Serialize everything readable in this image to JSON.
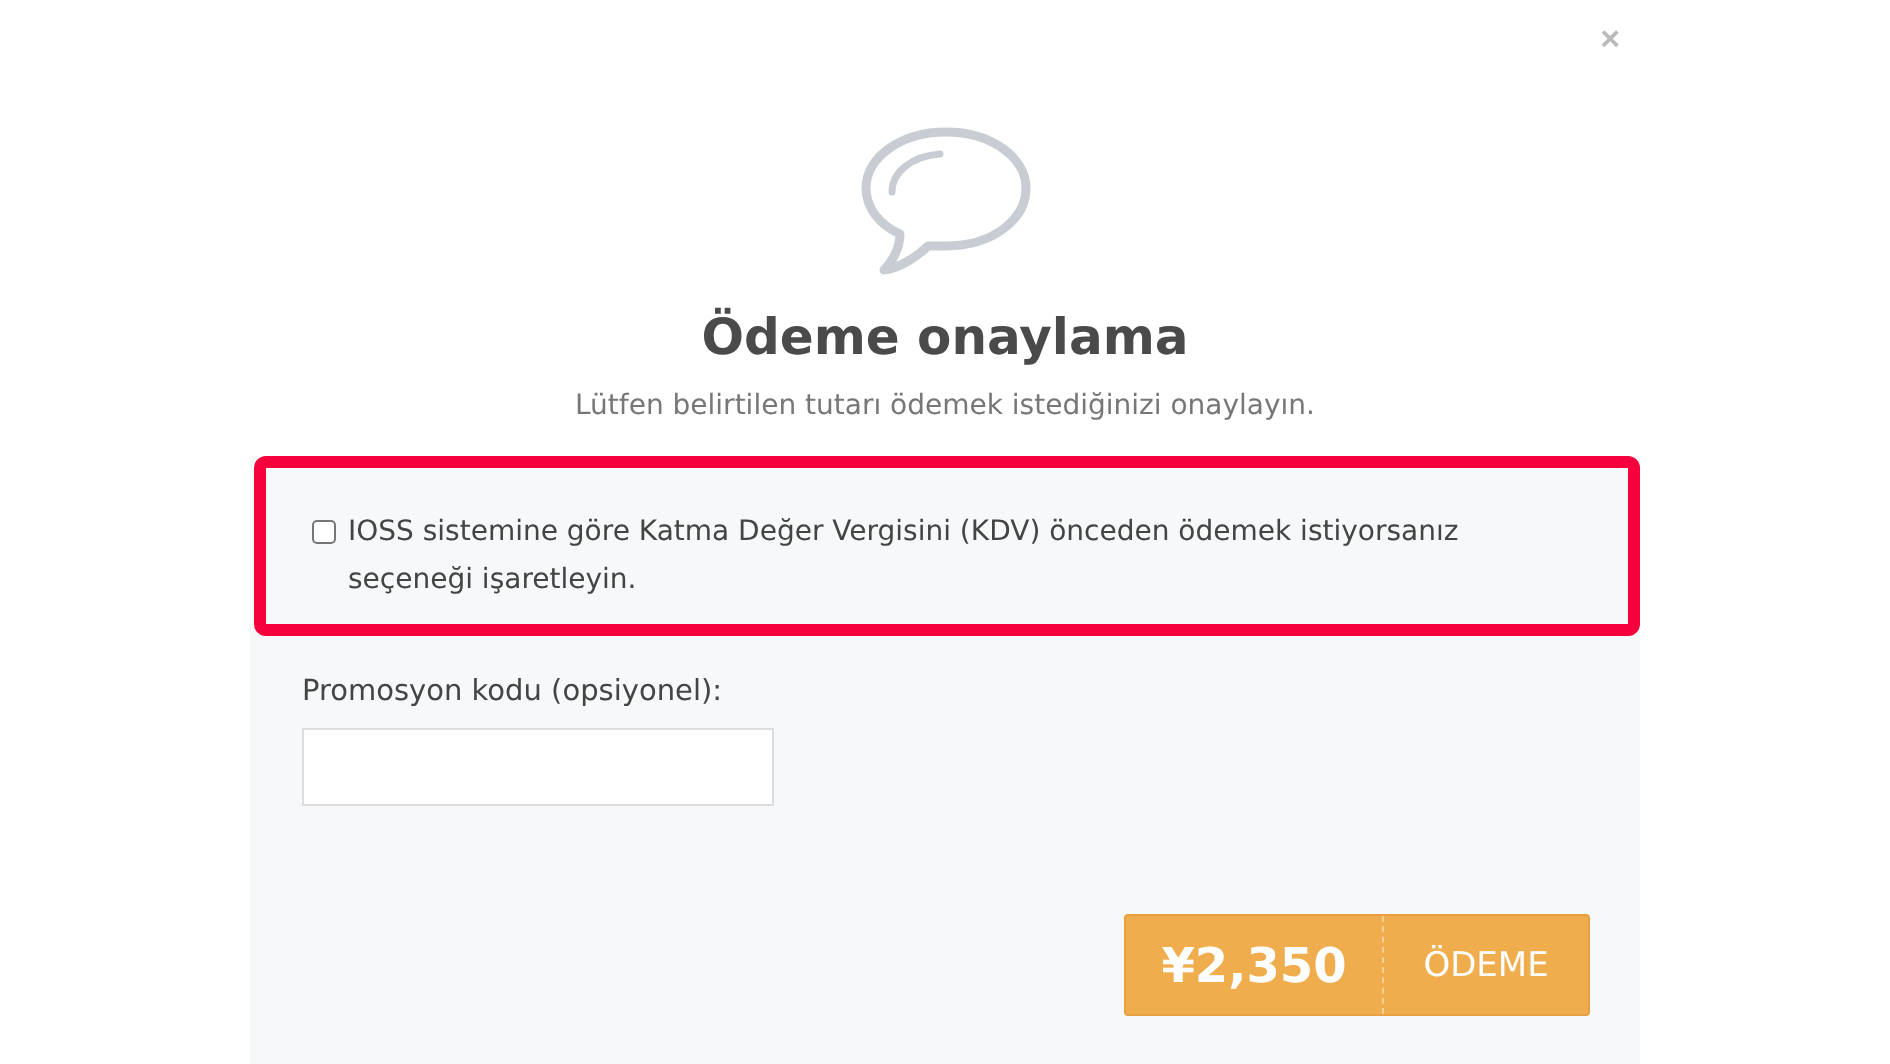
{
  "dialog": {
    "close": "×",
    "title": "Ödeme onaylama",
    "subtitle": "Lütfen belirtilen tutarı ödemek istediğinizi onaylayın."
  },
  "ioss_option": {
    "label": "IOSS sistemine göre Katma Değer Vergisini (KDV) önceden ödemek istiyorsanız seçeneği işaretleyin.",
    "checked": false,
    "highlighted": true
  },
  "promo": {
    "label": "Promosyon kodu (opsiyonel):"
  },
  "pay_button": {
    "amount": "¥2,350",
    "label": "ÖDEME"
  }
}
